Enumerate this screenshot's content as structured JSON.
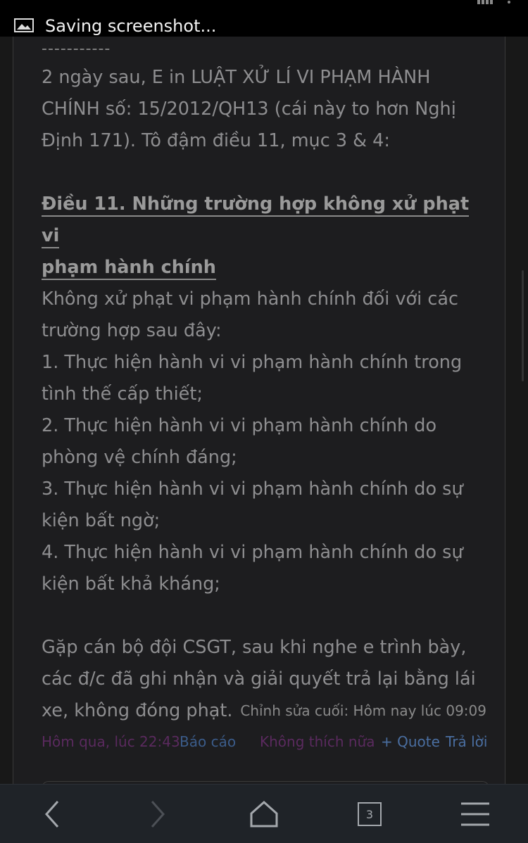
{
  "status_bar": {
    "notification_text": "Saving screenshot...",
    "icons": [
      "image-notification-icon",
      "signal-icon",
      "wifi-icon"
    ]
  },
  "post": {
    "divider": "-----------",
    "intro_lines": [
      "2 ngày sau, E in LUẬT XỬ LÍ VI PHẠM HÀNH",
      "CHÍNH số: 15/2012/QH13 (cái này to hơn Nghị",
      "Định 171). Tô đậm điều 11, mục 3 & 4:"
    ],
    "heading_lines": [
      "Điều 11. Những trường hợp không xử phạt vi",
      "phạm hành chính"
    ],
    "body_lines": [
      "Không xử phạt vi phạm hành chính đối với các",
      "trường hợp sau đây:",
      "1. Thực hiện hành vi vi phạm hành chính trong",
      "tình thế cấp thiết;",
      "2. Thực hiện hành vi vi phạm hành chính do",
      "phòng vệ chính đáng;",
      "3. Thực hiện hành vi vi phạm hành chính do sự",
      "kiện bất ngờ;",
      "4. Thực hiện hành vi vi phạm hành chính do sự",
      "kiện bất khả kháng;"
    ],
    "closing_lines": [
      "Gặp cán bộ đội CSGT, sau khi nghe e trình bày,",
      "các đ/c đã ghi nhận và giải quyết trả lại bằng lái",
      "xe, không đóng phạt."
    ],
    "edited_note": "Chỉnh sửa cuối: Hôm nay lúc 09:09"
  },
  "footer": {
    "date": "Hôm qua, lúc 22:43",
    "report": "Báo cáo",
    "unlike": "Không thích nữa",
    "quote": "+ Quote",
    "reply": "Trả lời"
  },
  "nav": {
    "tab_count": "3"
  },
  "colors": {
    "background": "#1d1d1f",
    "text": "#8e8e90",
    "link_blue": "#4a6ea0",
    "link_purple": "#5a2a5e",
    "nav_bar": "#1f2328"
  }
}
